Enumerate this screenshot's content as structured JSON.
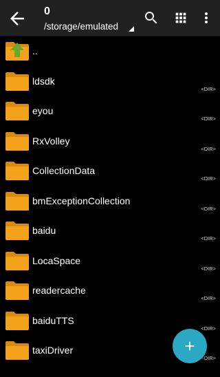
{
  "toolbar": {
    "title": "0",
    "path": "/storage/emulated"
  },
  "icons": {
    "back": "arrow-back-icon",
    "search": "search-icon",
    "grid": "grid-view-icon",
    "more": "more-vert-icon",
    "folder": "folder-icon",
    "parent": "folder-up-icon",
    "add": "plus-icon"
  },
  "colors": {
    "toolbar_bg": "#212121",
    "background": "#000000",
    "folder": "#F4A21A",
    "fab": "#2AA8C4",
    "up_arrow": "#6BA82E"
  },
  "list": {
    "parent": {
      "label": ".."
    },
    "items": [
      {
        "name": "ldsdk",
        "tag": "<DIR>"
      },
      {
        "name": "eyou",
        "tag": "<DIR>"
      },
      {
        "name": "RxVolley",
        "tag": "<DIR>"
      },
      {
        "name": "CollectionData",
        "tag": "<DIR>"
      },
      {
        "name": "bmExceptionCollection",
        "tag": "<DIR>"
      },
      {
        "name": "baidu",
        "tag": "<DIR>"
      },
      {
        "name": "LocaSpace",
        "tag": "<DIR>"
      },
      {
        "name": "readercache",
        "tag": "<DIR>"
      },
      {
        "name": "baiduTTS",
        "tag": "<DIR>"
      },
      {
        "name": "taxiDriver",
        "tag": "<DIR>"
      }
    ]
  }
}
